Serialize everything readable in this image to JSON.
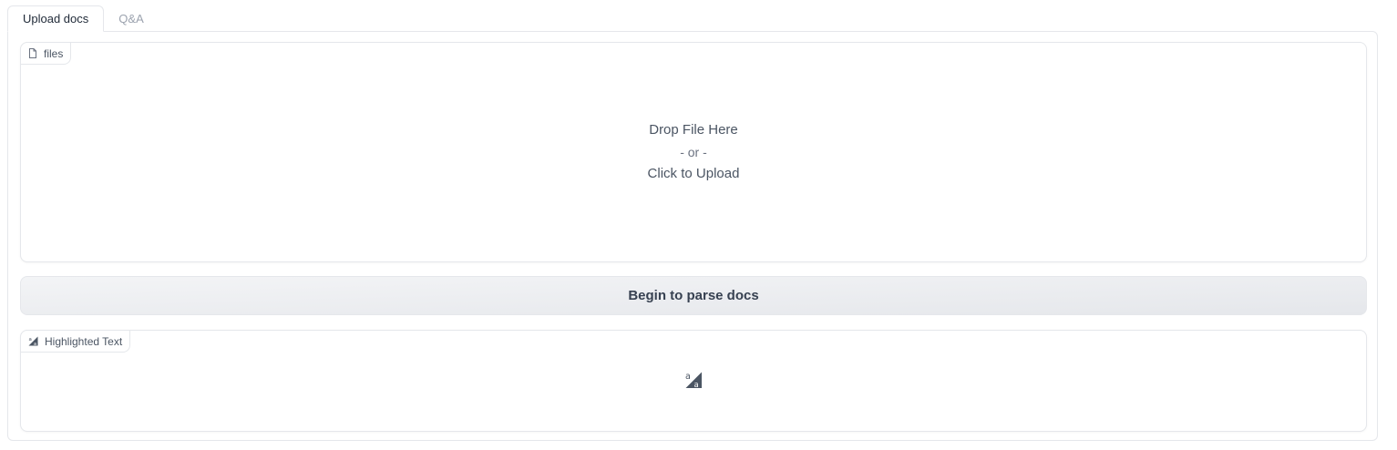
{
  "tabs": [
    {
      "label": "Upload docs",
      "active": true
    },
    {
      "label": "Q&A",
      "active": false
    }
  ],
  "files_block": {
    "label": "files",
    "icon": "file-icon",
    "drop_text": "Drop File Here",
    "or_text": "- or -",
    "click_text": "Click to Upload"
  },
  "parse_button": {
    "label": "Begin to parse docs"
  },
  "highlighted_block": {
    "label": "Highlighted Text",
    "icon": "text-highlight-icon",
    "empty_icon": "text-highlight-icon"
  },
  "colors": {
    "border": "#e5e7eb",
    "text": "#374151",
    "muted": "#9ca3af",
    "button_bg": "#f3f4f6"
  }
}
